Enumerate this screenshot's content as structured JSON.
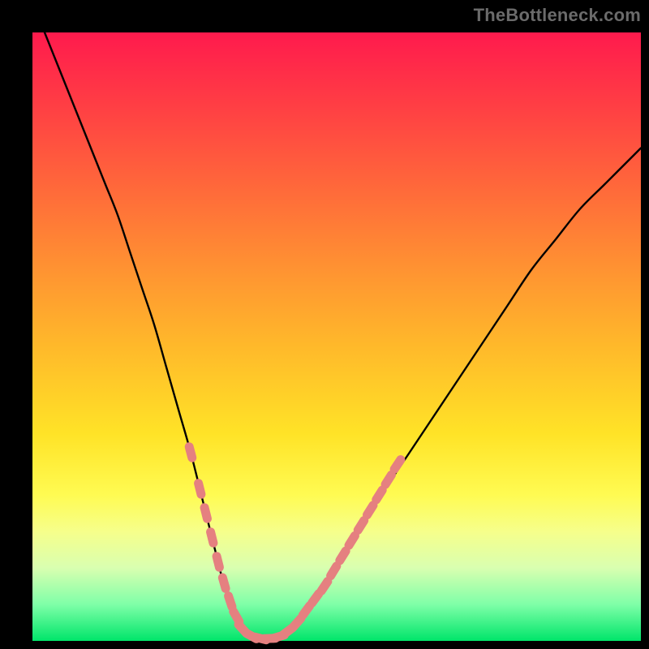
{
  "watermark": {
    "text": "TheBottleneck.com"
  },
  "colors": {
    "background": "#000000",
    "curve": "#000000",
    "marker_stroke": "#e58080",
    "marker_fill": "#e58080"
  },
  "chart_data": {
    "type": "line",
    "title": "",
    "xlabel": "",
    "ylabel": "",
    "xlim": [
      0,
      100
    ],
    "ylim": [
      0,
      100
    ],
    "grid": false,
    "legend": false,
    "notes": "V-shaped bottleneck curve on rainbow gradient; y represents distance above bottom edge (higher = worse match). Markers cluster on lower segments of both arms near the trough.",
    "series": [
      {
        "name": "bottleneck-curve",
        "x": [
          2,
          4,
          6,
          8,
          10,
          12,
          14,
          16,
          18,
          20,
          22,
          24,
          26,
          28,
          29,
          30,
          31,
          32,
          33,
          34,
          35,
          36,
          37,
          38,
          40,
          42,
          44,
          46,
          48,
          50,
          52,
          55,
          58,
          62,
          66,
          70,
          74,
          78,
          82,
          86,
          90,
          94,
          98,
          100
        ],
        "values": [
          100,
          95,
          90,
          85,
          80,
          75,
          70,
          64,
          58,
          52,
          45,
          38,
          31,
          23,
          19,
          15,
          11,
          8,
          5,
          3,
          1.5,
          0.8,
          0.4,
          0.3,
          0.5,
          1.5,
          3.5,
          6,
          9,
          12,
          15.5,
          20,
          25,
          31,
          37,
          43,
          49,
          55,
          61,
          66,
          71,
          75,
          79,
          81
        ]
      }
    ],
    "markers": {
      "name": "highlighted-points",
      "points": [
        {
          "x": 26,
          "y": 31
        },
        {
          "x": 27.5,
          "y": 25
        },
        {
          "x": 28.5,
          "y": 21
        },
        {
          "x": 29.5,
          "y": 17
        },
        {
          "x": 30.5,
          "y": 13
        },
        {
          "x": 31.5,
          "y": 9.5
        },
        {
          "x": 32.5,
          "y": 6.5
        },
        {
          "x": 33.5,
          "y": 4
        },
        {
          "x": 34.5,
          "y": 2
        },
        {
          "x": 36,
          "y": 0.8
        },
        {
          "x": 37.5,
          "y": 0.4
        },
        {
          "x": 39,
          "y": 0.4
        },
        {
          "x": 40.5,
          "y": 0.7
        },
        {
          "x": 42,
          "y": 1.6
        },
        {
          "x": 43.5,
          "y": 3
        },
        {
          "x": 45,
          "y": 5
        },
        {
          "x": 46.5,
          "y": 7
        },
        {
          "x": 48,
          "y": 9
        },
        {
          "x": 49.5,
          "y": 11.5
        },
        {
          "x": 51,
          "y": 14
        },
        {
          "x": 52.5,
          "y": 16.5
        },
        {
          "x": 54,
          "y": 19
        },
        {
          "x": 55.5,
          "y": 21.5
        },
        {
          "x": 57,
          "y": 24
        },
        {
          "x": 58.5,
          "y": 26.5
        },
        {
          "x": 60,
          "y": 29
        }
      ]
    }
  }
}
